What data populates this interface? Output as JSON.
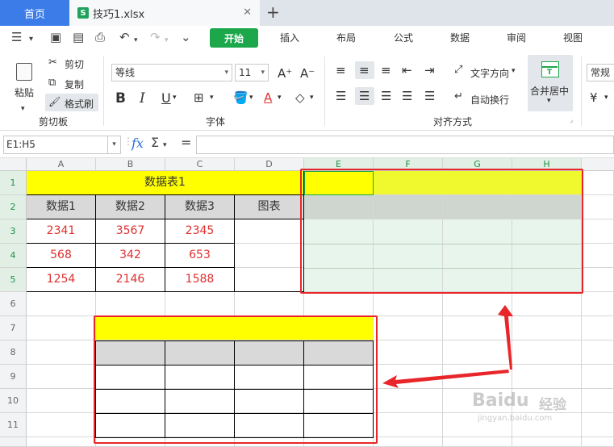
{
  "tabs": {
    "home": "首页",
    "file": "技巧1.xlsx",
    "file_icon": "S"
  },
  "menu": {
    "start": "开始",
    "insert": "插入",
    "layout": "布局",
    "formula": "公式",
    "data": "数据",
    "review": "审阅",
    "view": "视图"
  },
  "ribbon": {
    "paste": "粘贴",
    "cut": "剪切",
    "copy": "复制",
    "format_painter": "格式刷",
    "clipboard_group": "剪切板",
    "font_name": "等线",
    "font_size": "11",
    "font_group": "字体",
    "text_direction": "文字方向",
    "wrap_text": "自动换行",
    "merge_center": "合并居中",
    "align_group": "对齐方式",
    "number_format": "常规",
    "bold": "B",
    "italic": "I",
    "underline": "U"
  },
  "formula_bar": {
    "name_box": "E1:H5",
    "fx": "fx",
    "sigma": "Σ",
    "equals": "="
  },
  "columns": [
    "A",
    "B",
    "C",
    "D",
    "E",
    "F",
    "G",
    "H"
  ],
  "rows": [
    "1",
    "2",
    "3",
    "4",
    "5",
    "6",
    "7",
    "8",
    "9",
    "10",
    "11"
  ],
  "table1": {
    "title": "数据表1",
    "headers": [
      "数据1",
      "数据2",
      "数据3",
      "图表"
    ],
    "rows": [
      [
        "2341",
        "3567",
        "2345"
      ],
      [
        "568",
        "342",
        "653"
      ],
      [
        "1254",
        "2146",
        "1588"
      ]
    ]
  },
  "watermark": {
    "brand": "Baidu",
    "cn": "经验",
    "url": "jingyan.baidu.com"
  },
  "colors": {
    "accent_green": "#1ba74a",
    "highlight_red": "#e8262a",
    "yellow": "#ffff00",
    "gray": "#d9d9d9",
    "data_red": "#e03030"
  }
}
